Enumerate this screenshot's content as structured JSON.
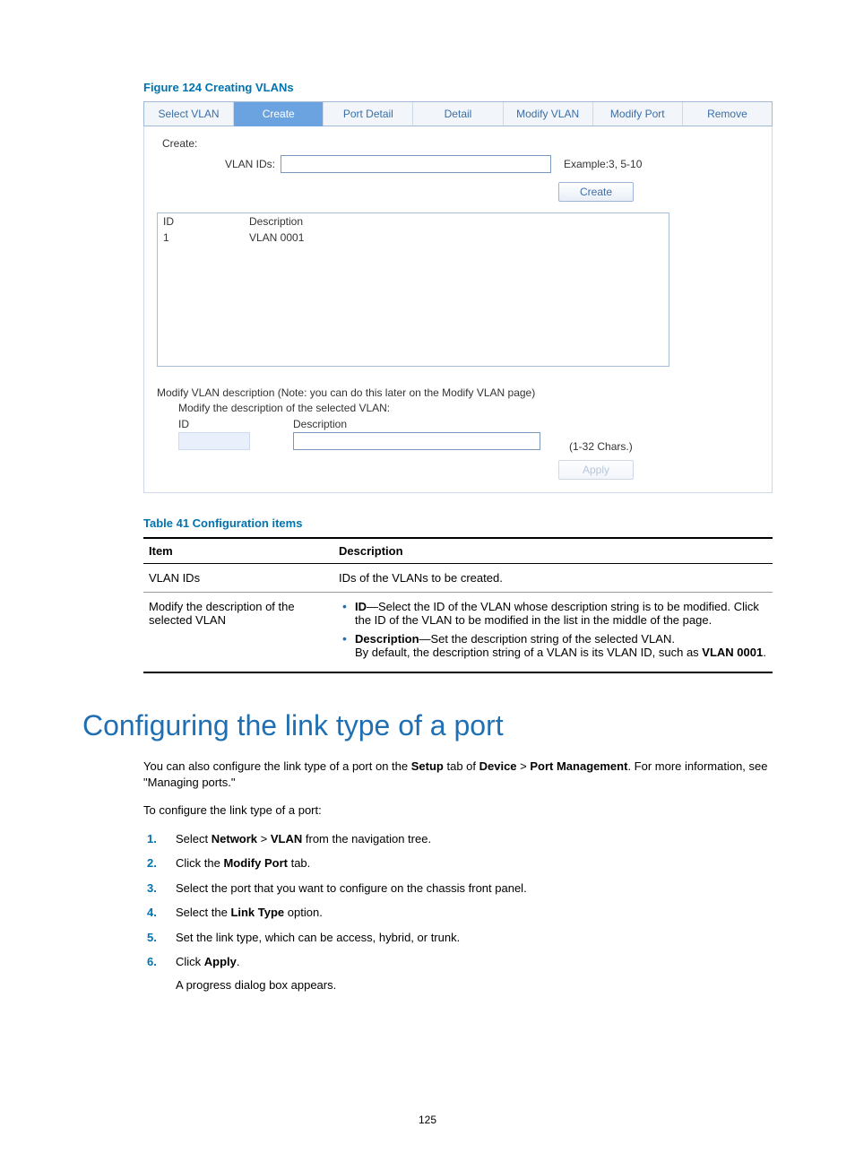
{
  "figure": {
    "caption": "Figure 124 Creating VLANs",
    "tabs": [
      "Select VLAN",
      "Create",
      "Port Detail",
      "Detail",
      "Modify VLAN",
      "Modify Port",
      "Remove"
    ],
    "active_tab_index": 1,
    "create_label": "Create:",
    "vlan_ids_label": "VLAN IDs:",
    "vlan_ids_value": "",
    "example_hint": "Example:3, 5-10",
    "create_button": "Create",
    "list_headers": {
      "id": "ID",
      "desc": "Description"
    },
    "list_rows": [
      {
        "id": "1",
        "desc": "VLAN 0001"
      }
    ],
    "modify_note": "Modify VLAN description (Note: you can do this later on the Modify VLAN page)",
    "modify_sub": "Modify the description of the selected VLAN:",
    "modify_headers": {
      "id": "ID",
      "desc": "Description"
    },
    "chars_hint": "(1-32 Chars.)",
    "apply_button": "Apply"
  },
  "table41": {
    "caption": "Table 41 Configuration items",
    "head": {
      "item": "Item",
      "desc": "Description"
    },
    "row1": {
      "item": "VLAN IDs",
      "desc": "IDs of the VLANs to be created."
    },
    "row2": {
      "item": "Modify the description of the selected VLAN",
      "b1_label": "ID",
      "b1_text": "—Select the ID of the VLAN whose description string is to be modified. Click the ID of the VLAN to be modified in the list in the middle of the page.",
      "b2_label": "Description",
      "b2_text_a": "—Set the description string of the selected VLAN.\nBy default, the description string of a VLAN is its VLAN ID, such as ",
      "b2_bold": "VLAN 0001",
      "b2_text_b": "."
    }
  },
  "heading": "Configuring the link type of a port",
  "intro": {
    "p1_a": "You can also configure the link type of a port on the ",
    "p1_setup": "Setup",
    "p1_b": " tab of ",
    "p1_device": "Device",
    "p1_gt": " > ",
    "p1_pm": "Port Management",
    "p1_c": ". For more information, see \"Managing ports.\"",
    "p2": "To configure the link type of a port:"
  },
  "steps": {
    "s1_a": "Select ",
    "s1_net": "Network",
    "s1_gt": " > ",
    "s1_vlan": "VLAN",
    "s1_b": " from the navigation tree.",
    "s2_a": "Click the ",
    "s2_mp": "Modify Port",
    "s2_b": " tab.",
    "s3": "Select the port that you want to configure on the chassis front panel.",
    "s4_a": "Select the ",
    "s4_lt": "Link Type",
    "s4_b": " option.",
    "s5": "Set the link type, which can be access, hybrid, or trunk.",
    "s6_a": "Click ",
    "s6_apply": "Apply",
    "s6_b": ".",
    "s6_sub": "A progress dialog box appears."
  },
  "page_number": "125"
}
